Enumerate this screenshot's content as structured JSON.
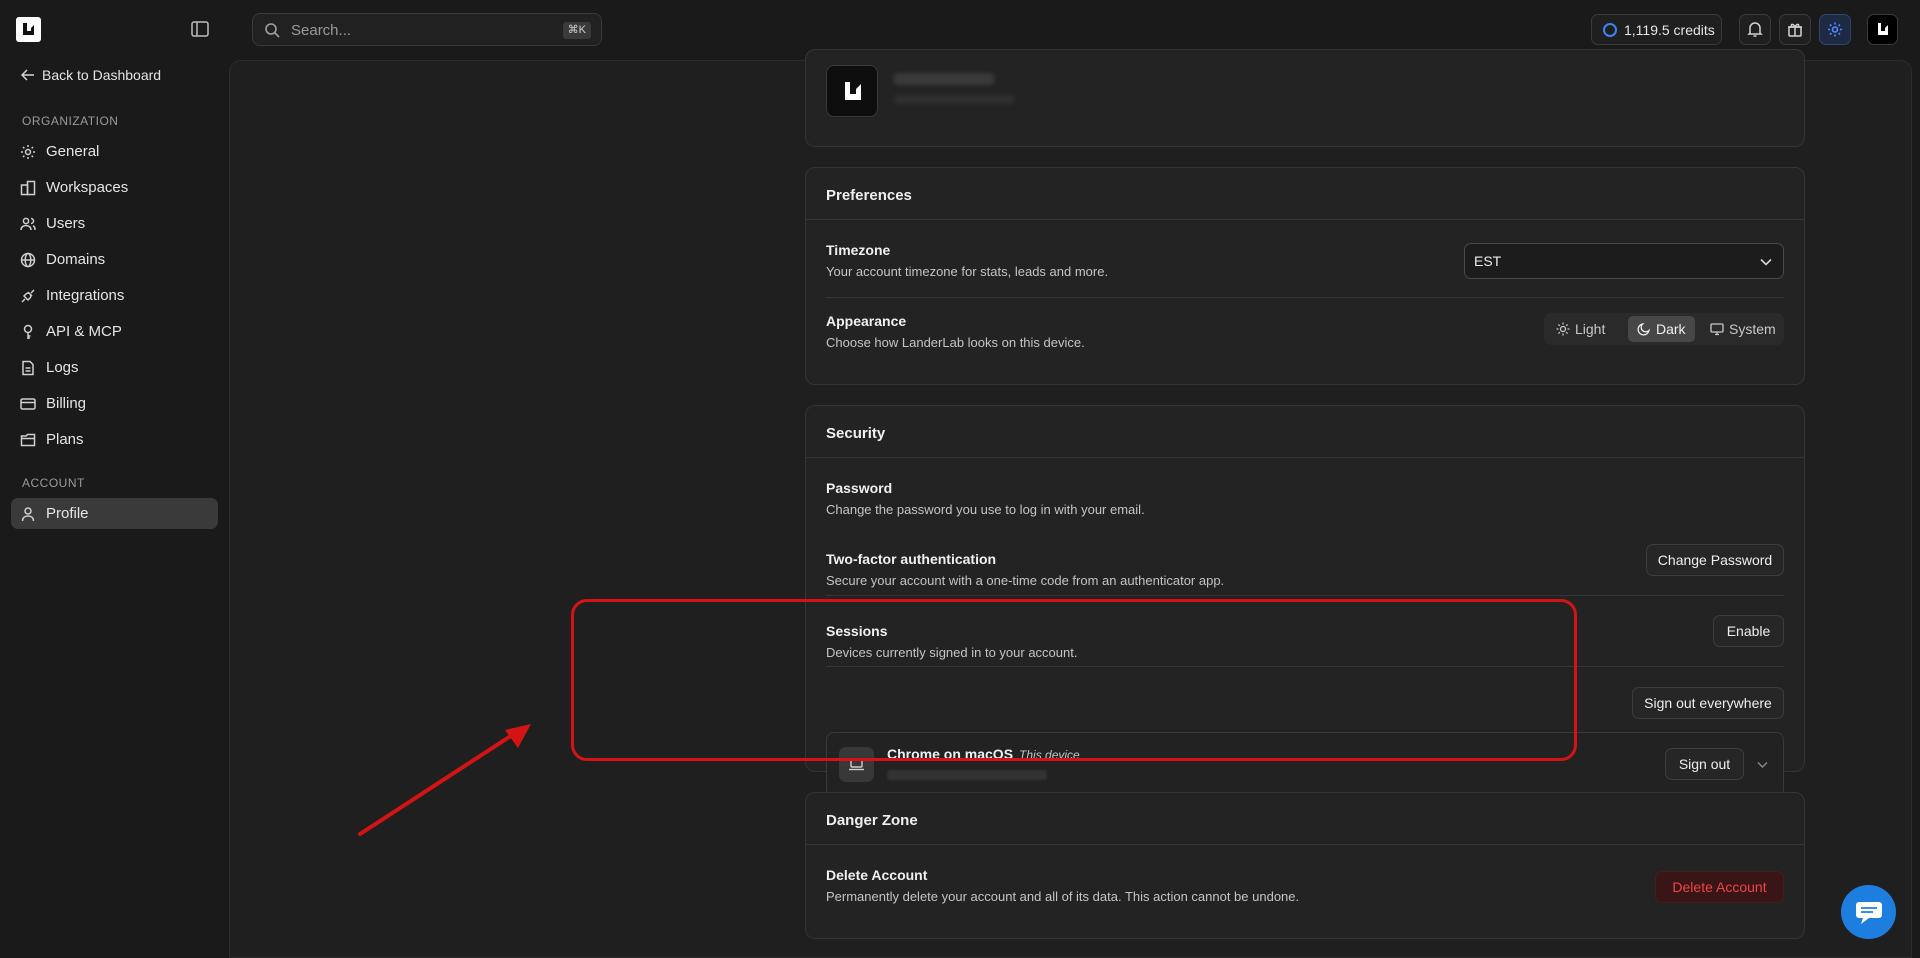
{
  "topbar": {
    "search_placeholder": "Search...",
    "search_shortcut": "⌘K",
    "credits_label": "1,119.5 credits",
    "icons": [
      "sidebar-toggle-icon",
      "search-icon",
      "bell-icon",
      "gift-icon",
      "gear-icon"
    ]
  },
  "sidebar": {
    "back_label": "Back to Dashboard",
    "org_section": "ORGANIZATION",
    "account_section": "ACCOUNT",
    "items": [
      {
        "label": "General",
        "icon": "gear-icon"
      },
      {
        "label": "Workspaces",
        "icon": "workspaces-icon"
      },
      {
        "label": "Users",
        "icon": "users-icon"
      },
      {
        "label": "Domains",
        "icon": "globe-icon"
      },
      {
        "label": "Integrations",
        "icon": "plug-icon"
      },
      {
        "label": "API & MCP",
        "icon": "key-icon"
      },
      {
        "label": "Logs",
        "icon": "logs-icon"
      },
      {
        "label": "Billing",
        "icon": "card-icon"
      },
      {
        "label": "Plans",
        "icon": "plans-icon"
      }
    ],
    "profile_label": "Profile",
    "active_item": "Profile"
  },
  "preferences": {
    "title": "Preferences",
    "timezone_title": "Timezone",
    "timezone_desc": "Your account timezone for stats, leads and more.",
    "timezone_value": "EST",
    "appearance_title": "Appearance",
    "appearance_desc": "Choose how LanderLab looks on this device.",
    "appearance_options": [
      "Light",
      "Dark",
      "System"
    ],
    "appearance_selected": "Dark"
  },
  "security": {
    "title": "Security",
    "password_title": "Password",
    "password_desc": "Change the password you use to log in with your email.",
    "password_button": "Change Password",
    "twofa_title": "Two-factor authentication",
    "twofa_desc": "Secure your account with a one-time code from an authenticator app.",
    "twofa_button": "Enable",
    "sessions_title": "Sessions",
    "sessions_desc": "Devices currently signed in to your account.",
    "sessions_button": "Sign out everywhere",
    "session_device": "Chrome on macOS",
    "session_tag": "This device",
    "session_signout": "Sign out"
  },
  "danger": {
    "title": "Danger Zone",
    "delete_title": "Delete Account",
    "delete_desc": "Permanently delete your account and all of its data. This action cannot be undone.",
    "delete_button": "Delete Account"
  },
  "colors": {
    "accent": "#3b82f6",
    "highlight": "#d41414",
    "danger": "#ef4444",
    "chat": "#1e7ee0"
  }
}
